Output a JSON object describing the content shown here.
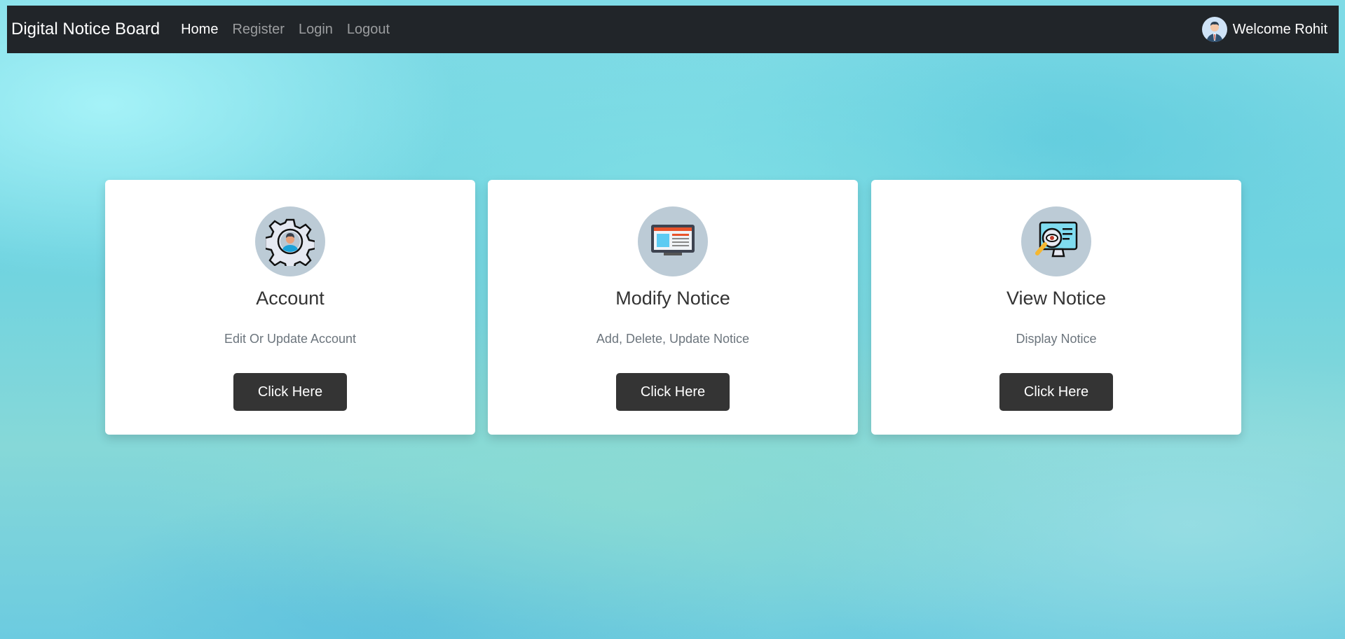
{
  "navbar": {
    "brand": "Digital Notice Board",
    "links": [
      "Home",
      "Register",
      "Login",
      "Logout"
    ],
    "active": "Home",
    "welcome": "Welcome Rohit"
  },
  "cards": [
    {
      "title": "Account",
      "description": "Edit Or Update Account",
      "button": "Click Here",
      "icon": "account-settings-icon"
    },
    {
      "title": "Modify Notice",
      "description": "Add, Delete, Update Notice",
      "button": "Click Here",
      "icon": "modify-notice-icon"
    },
    {
      "title": "View Notice",
      "description": "Display Notice",
      "button": "Click Here",
      "icon": "view-notice-icon"
    }
  ]
}
